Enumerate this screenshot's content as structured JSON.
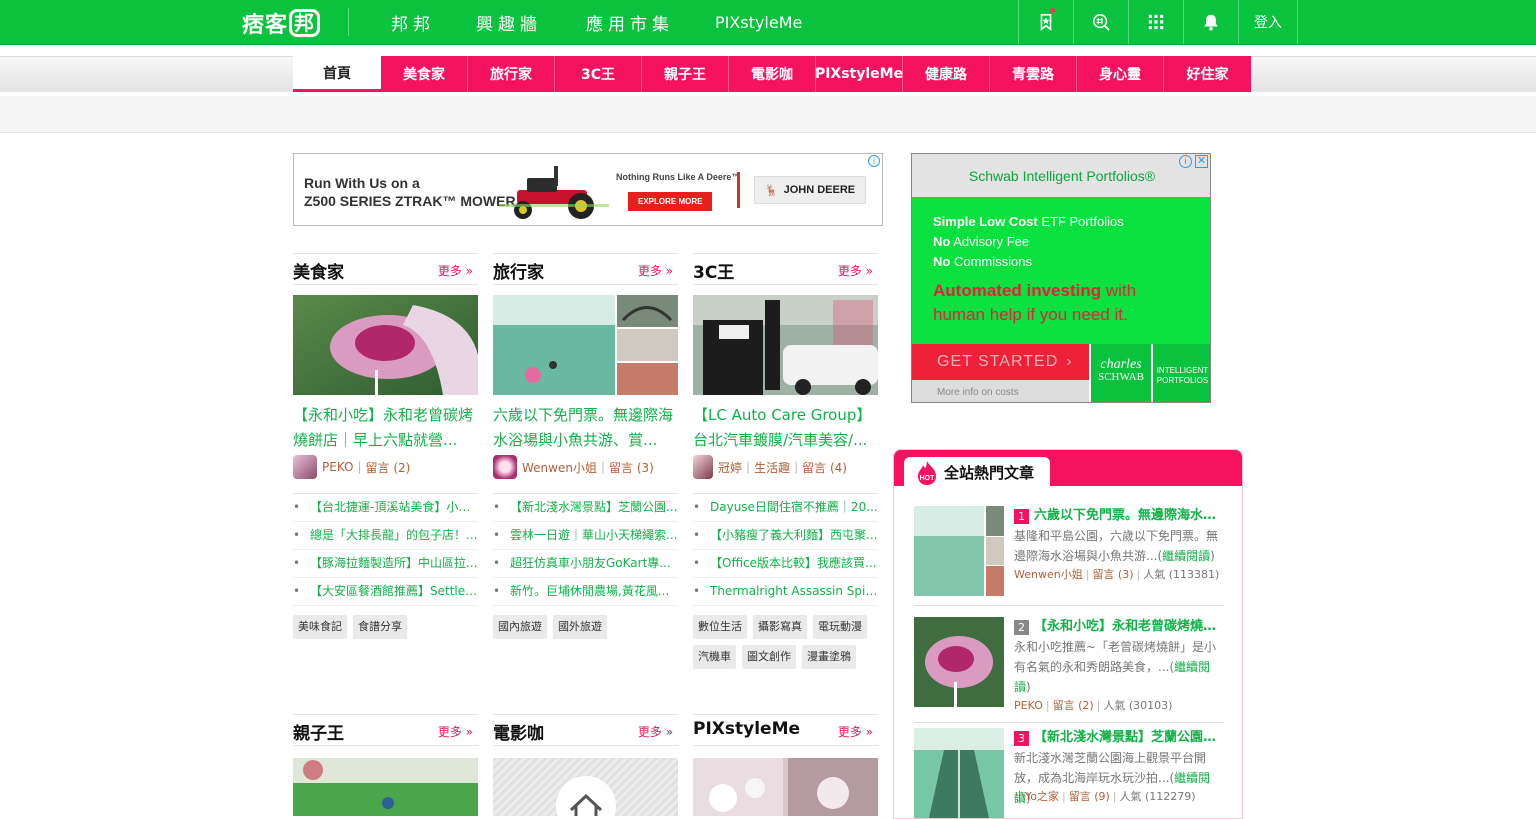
{
  "topbar": {
    "logo_text": "痞客",
    "logo_box": "邦",
    "nav": [
      "邦邦",
      "興趣牆",
      "應用市集",
      "PIXstyleMe"
    ],
    "icons": [
      "bookmark-star-icon",
      "search-hash-icon",
      "apps-grid-icon",
      "bell-icon"
    ],
    "login_label": "登入"
  },
  "categories": [
    "首頁",
    "美食家",
    "旅行家",
    "3C王",
    "親子王",
    "電影咖",
    "PIXstyleMe",
    "健康路",
    "青雲路",
    "身心靈",
    "好住家"
  ],
  "banner_ad": {
    "headline_1": "Run With Us on a",
    "headline_2": "Z500 SERIES ZTRAK™ MOWER",
    "tagline": "Nothing Runs Like A Deere™",
    "cta": "EXPLORE MORE",
    "brand": "JOHN DEERE",
    "adchoice": "i"
  },
  "more_label": "更多 »",
  "sections": [
    {
      "title": "美食家",
      "feature_title": "【永和小吃】永和老曾碳烤燒餅店｜早上六點就營...",
      "author": "PEKO",
      "author_category": "",
      "comments": "留言 (2)",
      "bullets": [
        "【台北捷運-頂溪站美食】小吃...",
        "總是「大排長龍」的包子店！...",
        "【豚海拉麵製造所】中山區拉...",
        "【大安區餐酒館推薦】Settle ..."
      ],
      "tags": [
        "美味食記",
        "食譜分享"
      ]
    },
    {
      "title": "旅行家",
      "feature_title": "六歲以下免門票。無邊際海水浴場與小魚共游、賞...",
      "author": "Wenwen小姐",
      "author_category": "",
      "comments": "留言 (3)",
      "bullets": [
        "【新北淺水灣景點】芝蘭公園...",
        "雲林一日遊｜華山小天梯繩索...",
        "超狂仿真車小朋友GoKart專...",
        "新竹。巨埔休閒農場,黃花風..."
      ],
      "tags": [
        "國內旅遊",
        "國外旅遊"
      ]
    },
    {
      "title": "3C王",
      "feature_title": "【LC Auto Care Group】台北汽車鍍膜/汽車美容/...",
      "author": "冠婷",
      "author_category": "生活趣",
      "comments": "留言 (4)",
      "bullets": [
        "Dayuse日間住宿不推薦｜20...",
        "【小豬瘦了義大利麵】西屯聚...",
        "【Office版本比較】我應該買...",
        "Thermalright Assassin Spirit ..."
      ],
      "tags": [
        "數位生活",
        "攝影寫真",
        "電玩動漫",
        "汽機車",
        "圖文創作",
        "漫畫塗鴉"
      ]
    }
  ],
  "lower_sections": [
    "親子王",
    "電影咖",
    "PIXstyleMe"
  ],
  "side_ad": {
    "header": "Schwab Intelligent Portfolios®",
    "line1_bold": "Simple Low Cost",
    "line1_rest": " ETF Portfolios",
    "line2_bold": "No",
    "line2_rest": " Advisory Fee",
    "line3_bold": "No",
    "line3_rest": " Commissions",
    "big_bold": "Automated investing",
    "big_rest": " with",
    "big_line2": "human help if you need it.",
    "cta": "GET STARTED",
    "more_info": "More info on costs",
    "brand1": "charles",
    "brand2": "SCHWAB",
    "brand3": "INTELLIGENT",
    "brand4": "PORTFOLIOS"
  },
  "hot_panel": {
    "title": "全站熱門文章",
    "badge": "HOT",
    "continue_label": "繼續閱讀",
    "items": [
      {
        "rank": "1",
        "title": "六歲以下免門票。無邊際海水浴...",
        "desc": "基隆和平島公園，六歲以下免門票。無邊際海水浴場與小魚共游...(",
        "author": "Wenwen小姐",
        "comments": "留言 (3)",
        "popularity": "人氣 (113381)",
        "rank_color": "#f6125e"
      },
      {
        "rank": "2",
        "title": "【永和小吃】永和老曾碳烤燒餅店...",
        "desc": "永和小吃推薦~「老曾碳烤燒餅」是小有名氣的永和秀朗路美食，...(",
        "author": "PEKO",
        "comments": "留言 (2)",
        "popularity": "人氣 (30103)",
        "rank_color": "#888888"
      },
      {
        "rank": "3",
        "title": "【新北淺水灣景點】芝蘭公園海上...",
        "desc": "新北淺水灣芝蘭公園海上觀景平台開放，成為北海岸玩水玩沙拍...(",
        "author": "小Yo之家",
        "comments": "留言 (9)",
        "popularity": "人氣 (112279)",
        "rank_color": "#f6125e"
      }
    ]
  },
  "colors": {
    "brand_green": "#09c33e",
    "accent_pink": "#f6125e",
    "link_green": "#13b24a"
  }
}
